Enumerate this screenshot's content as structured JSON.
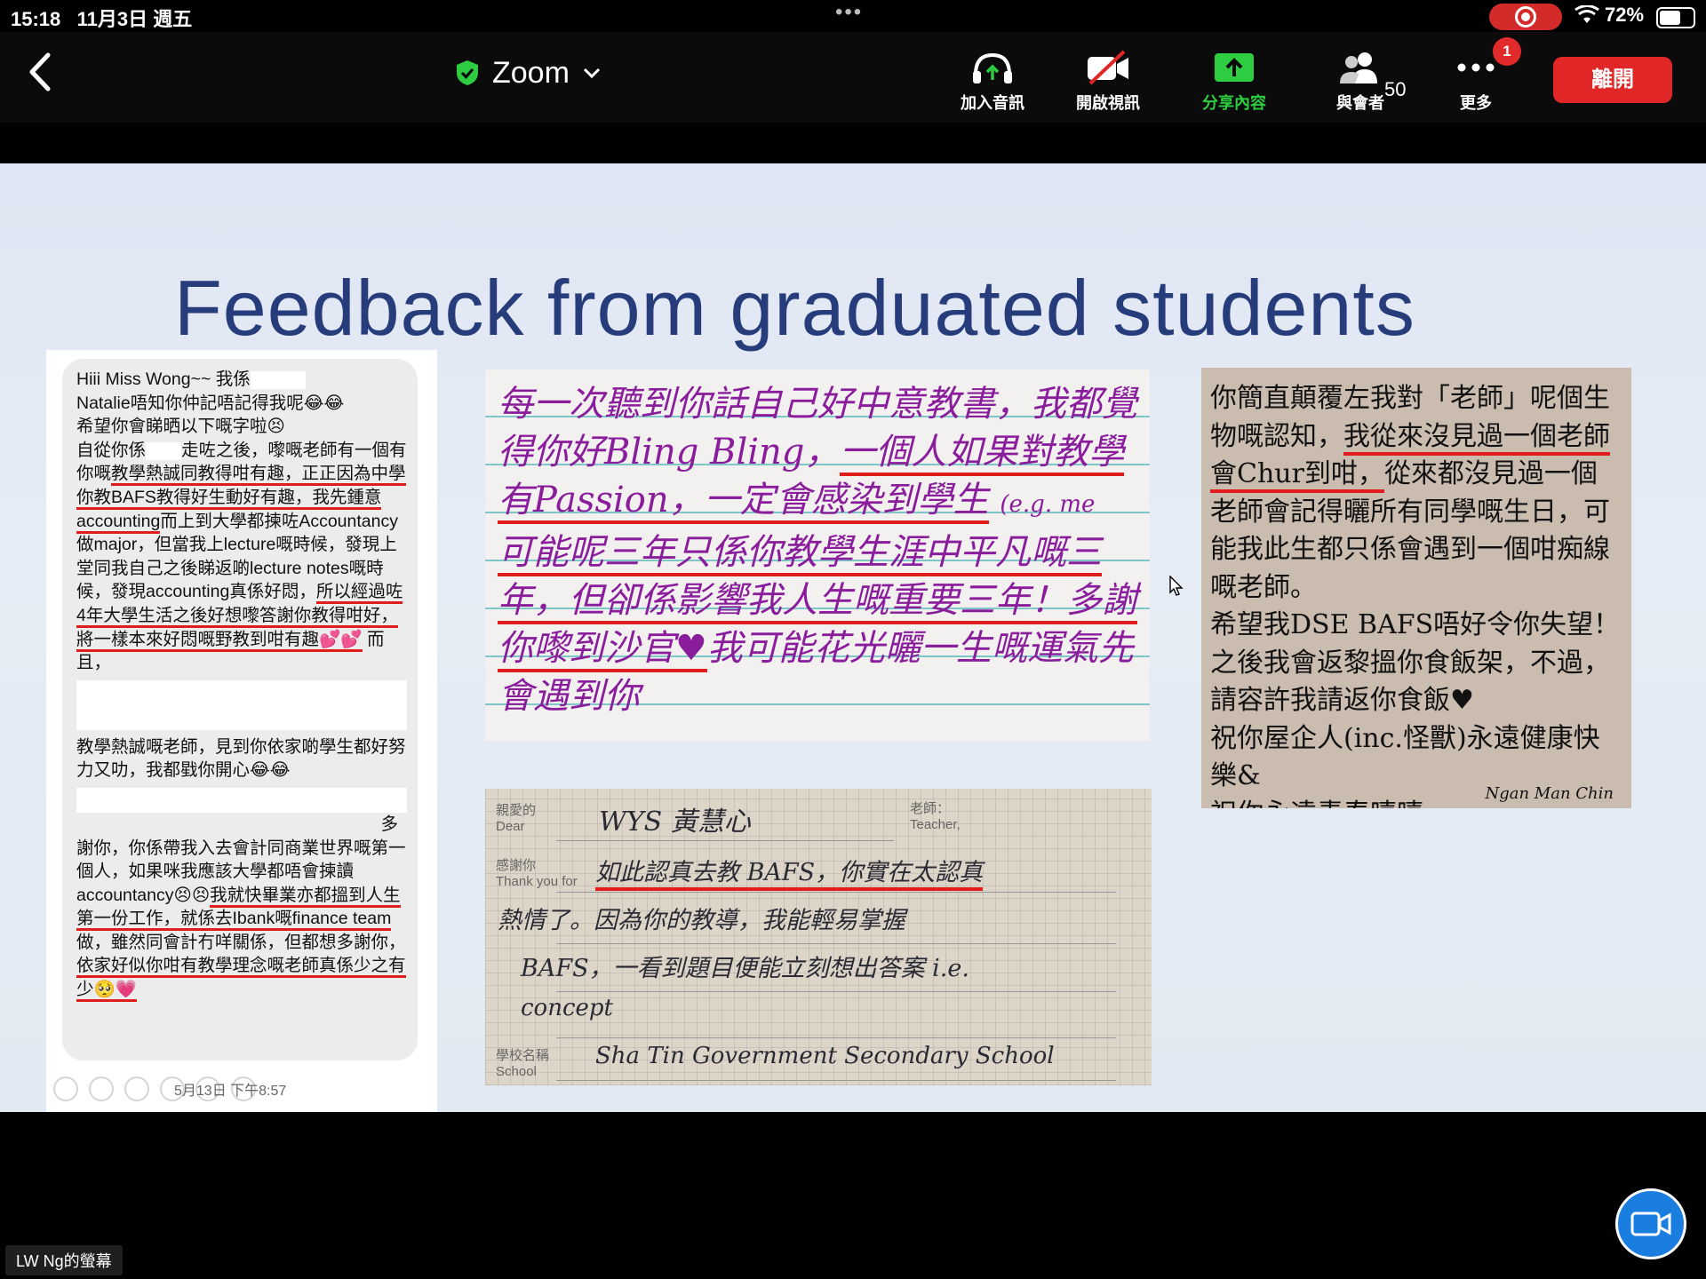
{
  "status_bar": {
    "time": "15:18",
    "date": "11月3日 週五",
    "battery": "72%",
    "battery_level": 0.72
  },
  "toolbar": {
    "back_label": "",
    "meeting_title": "Zoom",
    "buttons": {
      "join_audio": "加入音訊",
      "start_video": "開啟視訊",
      "share": "分享內容",
      "participants": "與會者",
      "more": "更多"
    },
    "participants_count": "50",
    "more_badge": "1",
    "leave": "離開"
  },
  "slide": {
    "title": "Feedback from graduated students",
    "chat": {
      "lines": [
        "Hiii Miss Wong~~ 我係",
        "Natalie唔知你仲記唔記得我呢😂😂",
        "希望你會睇晒以下嘅字啦😣",
        "自從你係",
        "走咗之後，嚟嘅老師有一個有你嘅",
        "教學熱誠同教得咁有趣，正正因為中學你教BAFS教得好生動好有趣，我先鍾意accounting",
        "而上到大學都揀咗Accountancy做major，但當我上lecture嘅時候，發現上堂同我自己之後睇返啲lecture notes嘅時候，發現accounting真係好悶，",
        "所以經過咗4年大學生活之後好想嚟答謝你教得咁好，將一樣本來好悶嘅野教到咁有趣💕💕",
        "而且，",
        "教學熱誠嘅老師，見到你依家啲學生都好努力又叻，我都戥你開心😂😂",
        "多",
        "謝你，你係帶我入去會計同商業世界嘅第一個人，如果咪我應該大學都唔會揀讀accountancy😣😣",
        "我就快畢業亦都搵到人生第一份工作，就係去Ibank嘅finance team",
        "做，雖然同會計冇咩關係，但都想多謝你，",
        "依家好似你咁有教學理念嘅老師真係少之有少🥺💗"
      ],
      "timestamp": "5月13日 下午8:57"
    },
    "card1": {
      "lines": [
        "每一次聽到你話自己好中意教書，我都覺得你好Bling Bling，",
        "一個人如果對教學有Passion，一定會感染到學生",
        "(e.g. me",
        "可能呢三年只係你教學生涯中平凡嘅三年，但卻係影響我人生嘅重要三年！",
        "多謝你嚟到沙官♥",
        "我可能花光曬一生嘅運氣先會遇到你"
      ]
    },
    "card2": {
      "dear_label": "親愛的",
      "dear_label_en": "Dear",
      "teacher_label": "老師：",
      "teacher_label_en": "Teacher,",
      "thanks_label": "感謝你",
      "thanks_label_en": "Thank you for",
      "school_label": "學校名稱",
      "school_label_en": "School",
      "to": "WYS 黃慧心",
      "line1": "如此認真去教 BAFS，你實在太認真",
      "line2": "熱情了。因為你的教導，我能輕易掌握",
      "line3": "BAFS，一看到題目便能立刻想出答案 i.e.",
      "line4": "concept",
      "school": "Sha Tin Government Secondary School"
    },
    "card3": {
      "lines": [
        "你簡直顛覆左我對「老師」呢個生物嘅認知，",
        "我從來沒見過一個老師會Chur到咁，",
        "從來都沒見過一個老師會記得曬所有同學嘅生日，可能我此生都只係會遇到一個咁痴線嘅老師。",
        "希望我DSE BAFS唔好令你失望！",
        "之後我會返黎搵你食飯架，不過，請容許我請返你食飯♥",
        "祝你屋企人(inc.怪獸)永遠健康快樂&",
        "祝你永遠青春嘻嘻"
      ],
      "signature": "Ngan Man Chin"
    }
  },
  "footer": {
    "screen_owner": "LW Ng的螢幕"
  },
  "colors": {
    "accent_green": "#2ecc40",
    "leave_red": "#e02626",
    "slide_title": "#273c7a",
    "underline_red": "#e01c1c",
    "handwriting_purple": "#8a1d9c"
  }
}
